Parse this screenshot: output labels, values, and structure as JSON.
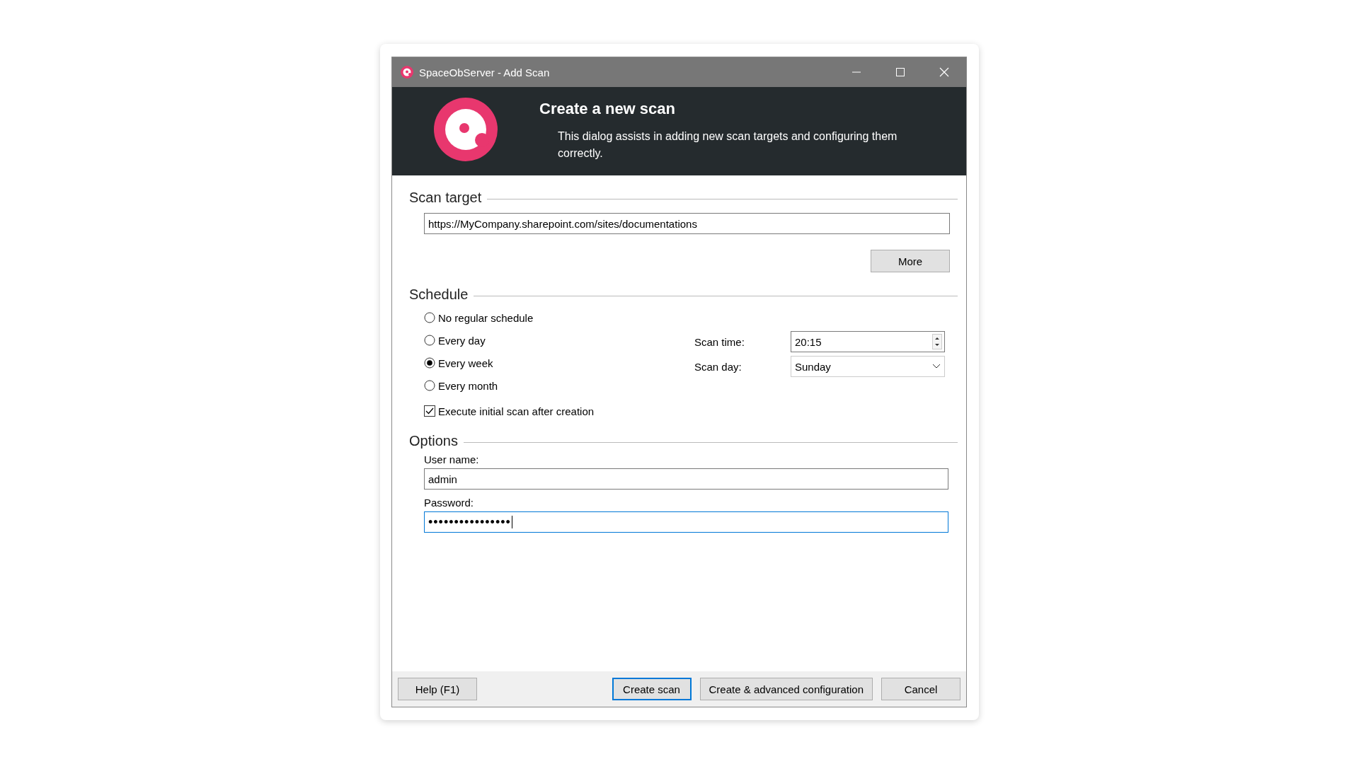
{
  "window": {
    "title": "SpaceObServer - Add Scan"
  },
  "header": {
    "title": "Create a new scan",
    "description": "This dialog assists in adding new scan targets and configuring them correctly."
  },
  "scan_target": {
    "heading": "Scan target",
    "url": "https://MyCompany.sharepoint.com/sites/documentations",
    "more_button": "More"
  },
  "schedule": {
    "heading": "Schedule",
    "options": [
      {
        "label": "No regular schedule",
        "selected": false
      },
      {
        "label": "Every day",
        "selected": false
      },
      {
        "label": "Every week",
        "selected": true
      },
      {
        "label": "Every month",
        "selected": false
      }
    ],
    "initial_scan": {
      "label": "Execute initial scan after creation",
      "checked": true
    },
    "scan_time": {
      "label": "Scan time:",
      "value": "20:15"
    },
    "scan_day": {
      "label": "Scan day:",
      "value": "Sunday"
    }
  },
  "options": {
    "heading": "Options",
    "user_name": {
      "label": "User name:",
      "value": "admin",
      "focused": false
    },
    "password": {
      "label": "Password:",
      "value": "••••••••••••••••",
      "focused": true
    }
  },
  "buttons": [
    {
      "label": "Help (F1)",
      "default": false
    },
    {
      "label": "Create scan",
      "default": true
    },
    {
      "label": "Create & advanced configuration",
      "default": false
    },
    {
      "label": "Cancel",
      "default": false
    }
  ]
}
